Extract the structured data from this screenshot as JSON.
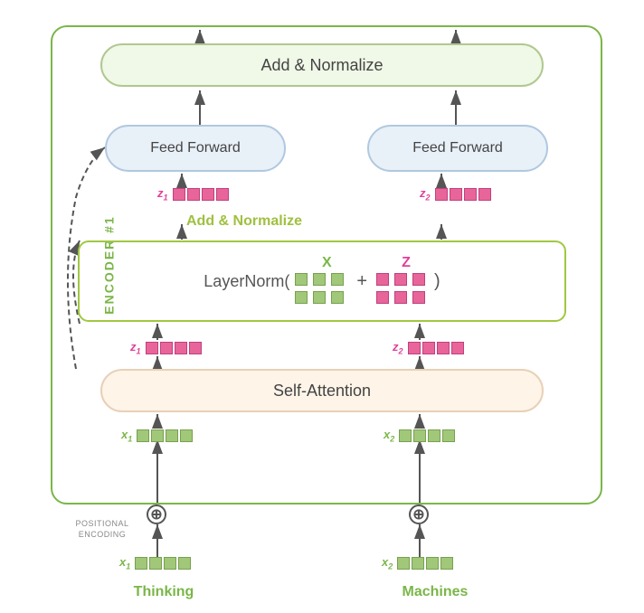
{
  "encoder": {
    "label": "ENCODER #1",
    "add_normalize_top": "Add & Normalize",
    "feed_forward_left": "Feed Forward",
    "feed_forward_right": "Feed Forward",
    "add_normalize_middle": "Add & Normalize",
    "layernorm": "LayerNorm(",
    "plus_sign": "+",
    "close_paren": ")",
    "self_attention": "Self-Attention",
    "x_label": "X",
    "z_label": "Z"
  },
  "inputs": {
    "thinking": "Thinking",
    "machines": "Machines",
    "z1_label": "z",
    "z2_label": "z",
    "x1_label": "x",
    "x2_label": "x",
    "z1_sub": "1",
    "z2_sub": "2",
    "x1_sub": "1",
    "x2_sub": "2",
    "positional_encoding": "POSITIONAL ENCODING",
    "plus": "⊕"
  },
  "colors": {
    "green_border": "#7ab648",
    "green_light": "#a0c878",
    "pink": "#e8659a",
    "blue_box": "#e8f0f8",
    "peach_box": "#fef4e8",
    "layernorm_border": "#a0c840"
  }
}
